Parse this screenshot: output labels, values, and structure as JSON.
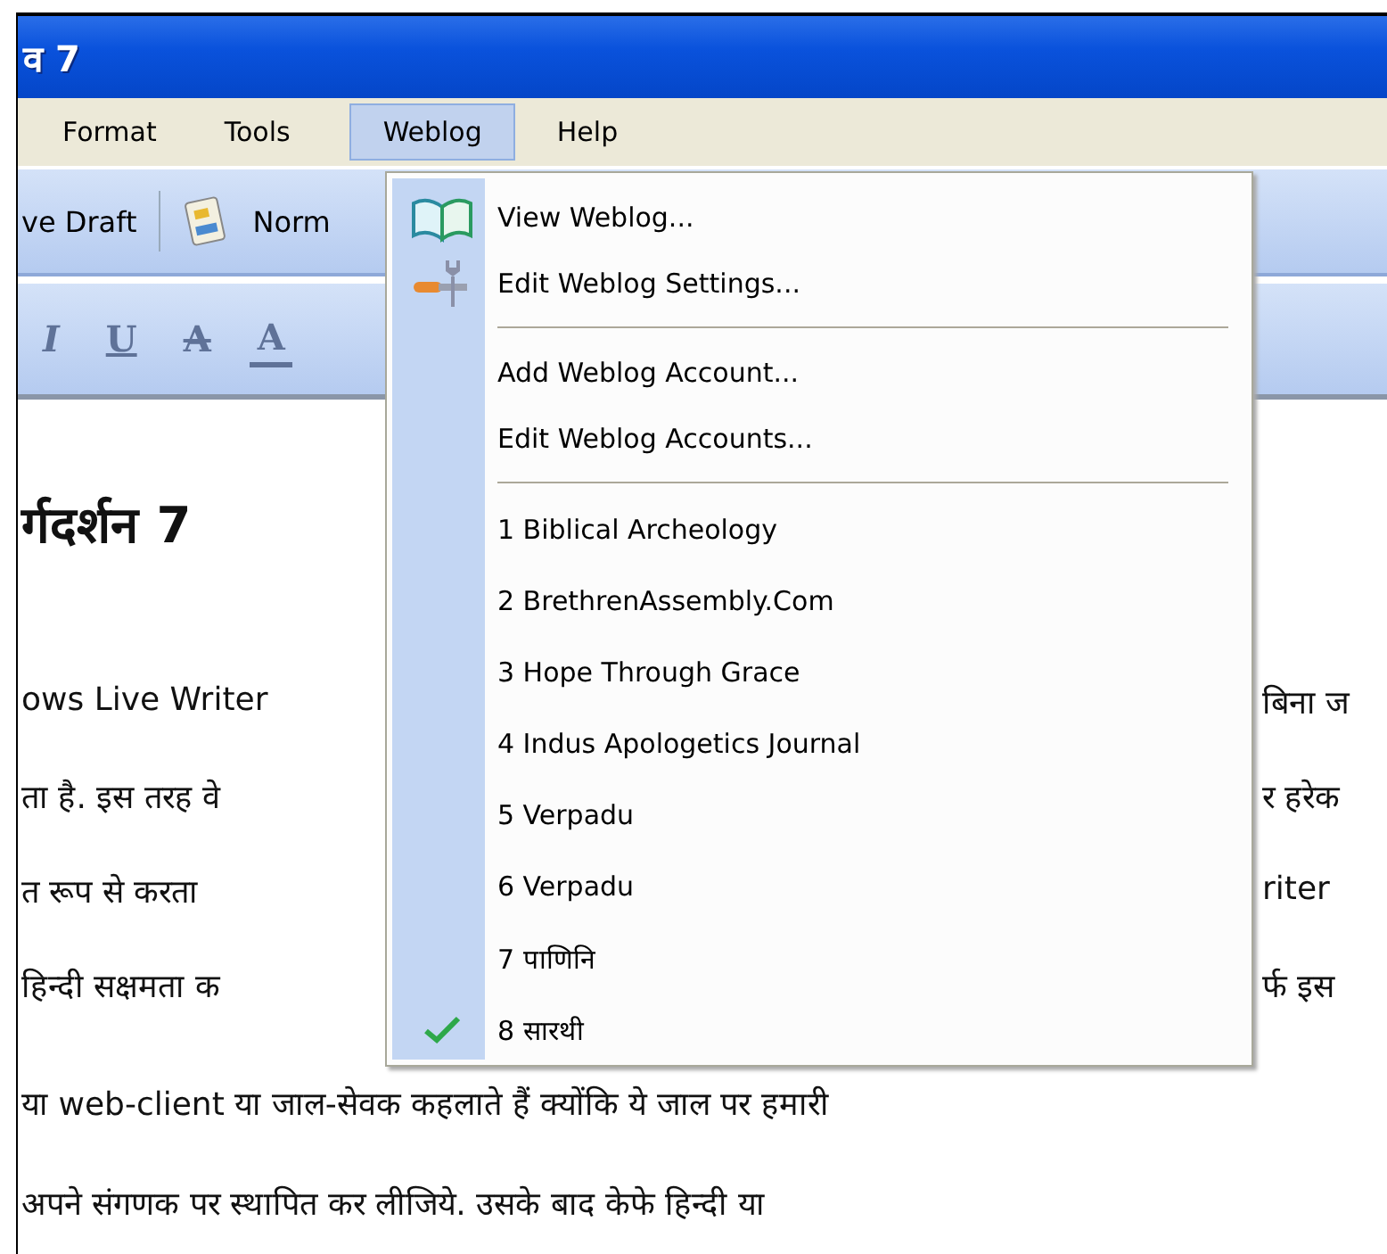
{
  "window": {
    "title": "व 7"
  },
  "menu_bar": [
    {
      "label": "Format",
      "selected": false
    },
    {
      "label": "Tools",
      "selected": false
    },
    {
      "label": "Weblog",
      "selected": true
    },
    {
      "label": "Help",
      "selected": false
    }
  ],
  "toolbar": {
    "save_draft": "ve Draft",
    "view": "Norm"
  },
  "format_toolbar": [
    {
      "label": "I",
      "kind": "italic",
      "disabled": true
    },
    {
      "label": "U",
      "kind": "underline",
      "disabled": true
    },
    {
      "label": "A",
      "kind": "strike",
      "disabled": true
    },
    {
      "label": "A",
      "kind": "color",
      "disabled": true
    }
  ],
  "document": {
    "heading": "र्गदर्शन 7",
    "lines": [
      {
        "left": "ows Live Writer",
        "right": "बिना ज"
      },
      {
        "left": "ता है. इस तरह वे",
        "right": "र हरेक"
      },
      {
        "left": "त रूप से करता",
        "right": "riter"
      },
      {
        "left": "हिन्दी सक्षमता क",
        "right": "र्फ इस"
      }
    ],
    "full_lines": [
      "या web-client या जाल-सेवक कहलाते हैं क्योंकि ये जाल पर हमारी",
      "अपने संगणक पर स्थापित कर लीजिये. उसके बाद केफे हिन्दी या"
    ]
  },
  "weblog_menu": [
    {
      "kind": "view",
      "label": "View Weblog..."
    },
    {
      "kind": "settings",
      "label": "Edit Weblog Settings..."
    },
    {
      "kind": "separator"
    },
    {
      "kind": "item",
      "label": "Add Weblog Account..."
    },
    {
      "kind": "item",
      "label": "Edit Weblog Accounts..."
    },
    {
      "kind": "separator"
    },
    {
      "kind": "account",
      "label": "1 Biblical Archeology",
      "checked": false
    },
    {
      "kind": "account",
      "label": "2 BrethrenAssembly.Com",
      "checked": false
    },
    {
      "kind": "account",
      "label": "3 Hope Through Grace",
      "checked": false
    },
    {
      "kind": "account",
      "label": "4 Indus Apologetics Journal",
      "checked": false
    },
    {
      "kind": "account",
      "label": "5 Verpadu",
      "checked": false
    },
    {
      "kind": "account",
      "label": "6 Verpadu",
      "checked": false
    },
    {
      "kind": "account",
      "label": "7 पाणिनि",
      "checked": false
    },
    {
      "kind": "account",
      "label": "8 सारथी",
      "checked": true
    }
  ]
}
